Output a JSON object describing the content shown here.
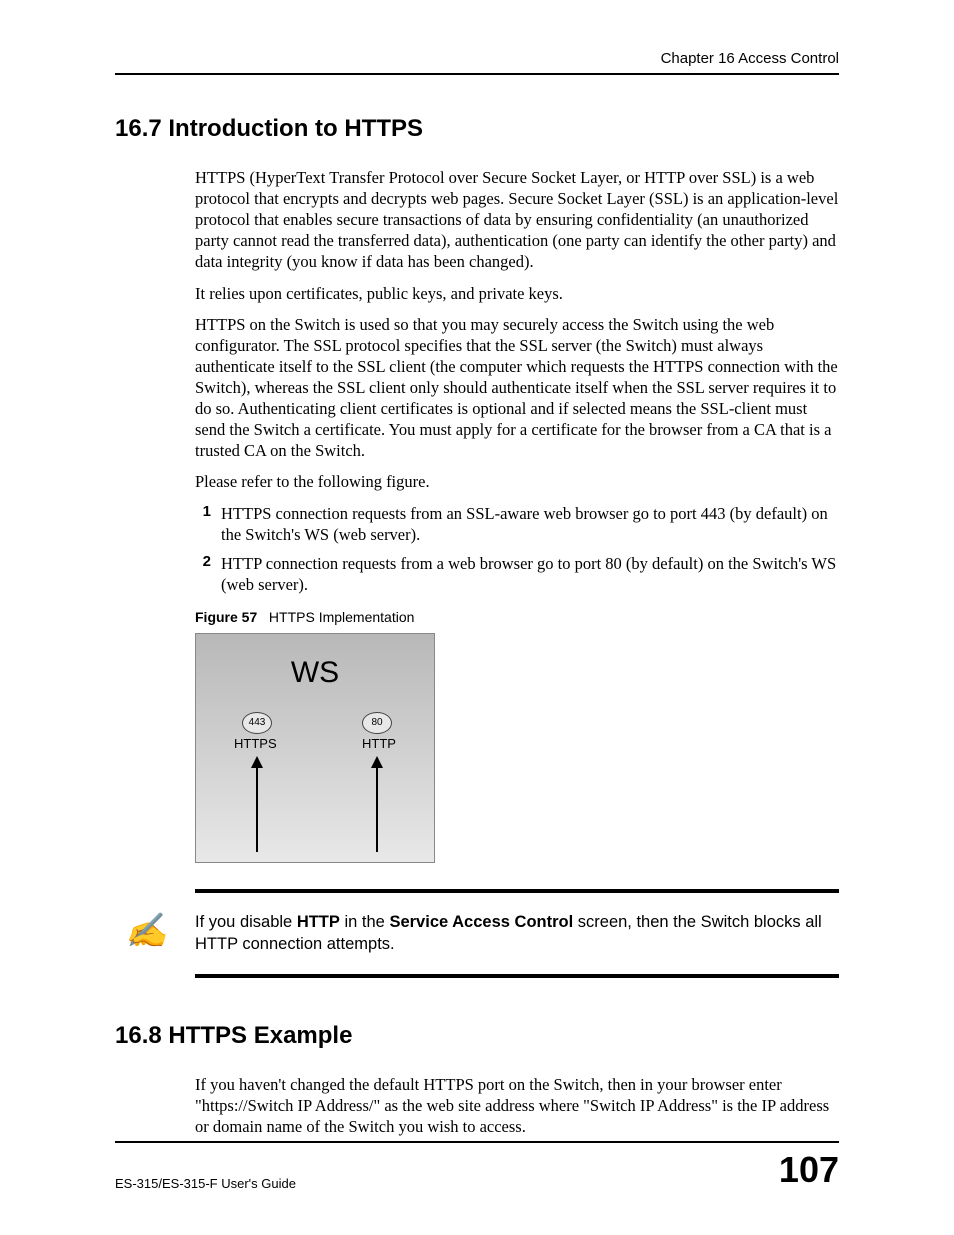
{
  "header": {
    "chapter": "Chapter 16 Access Control"
  },
  "section1": {
    "heading": "16.7  Introduction to HTTPS",
    "p1": "HTTPS (HyperText Transfer Protocol over Secure Socket Layer, or HTTP over SSL) is a web protocol that encrypts and decrypts web pages. Secure Socket Layer (SSL) is an application-level protocol that enables secure transactions of data by ensuring confidentiality (an unauthorized party cannot read the transferred data), authentication (one party can identify the other party) and data integrity (you know if data has been changed).",
    "p2": "It relies upon certificates, public keys, and private keys.",
    "p3": "HTTPS on the Switch is used so that you may securely access the Switch using the web configurator. The SSL protocol specifies that the SSL server (the Switch) must always authenticate itself to the SSL client (the computer which requests the HTTPS connection with the Switch), whereas the SSL client only should authenticate itself when the SSL server requires it to do so. Authenticating client certificates is optional and if selected means the SSL-client must send the Switch a certificate. You must apply for a certificate for the browser from a CA that is a trusted CA on the Switch.",
    "p4": "Please refer to the following figure.",
    "list": [
      {
        "n": "1",
        "t": "HTTPS connection requests from an SSL-aware web browser go to port 443 (by default) on the Switch's WS (web server)."
      },
      {
        "n": "2",
        "t": "HTTP connection requests from a web browser go to port 80 (by default) on the Switch's WS (web server)."
      }
    ],
    "figure": {
      "label": "Figure 57",
      "title": "HTTPS Implementation",
      "ws": "WS",
      "port443": "443",
      "port80": "80",
      "https": "HTTPS",
      "http": "HTTP"
    },
    "note": {
      "pre": "If you disable ",
      "b1": "HTTP",
      "mid": " in the ",
      "b2": "Service Access Control",
      "post": " screen, then the Switch blocks all HTTP connection attempts."
    }
  },
  "section2": {
    "heading": "16.8  HTTPS Example",
    "p1": "If you haven't changed the default HTTPS port on the Switch, then in your browser enter \"https://Switch IP Address/\" as the web site address where \"Switch IP Address\" is the IP address or domain name of the Switch you wish to access."
  },
  "footer": {
    "guide": "ES-315/ES-315-F User's Guide",
    "page": "107"
  }
}
